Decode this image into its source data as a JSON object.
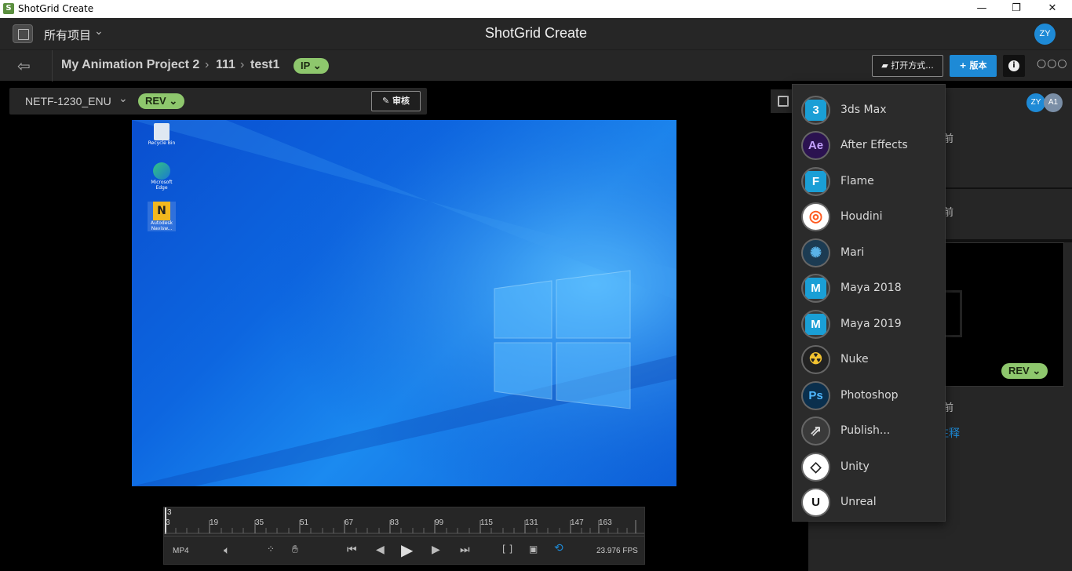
{
  "window": {
    "title": "ShotGrid Create",
    "minimize": "—",
    "restore": "❐",
    "close": "✕"
  },
  "header": {
    "projects_label": "所有项目",
    "app_title": "ShotGrid Create",
    "user_initials": "ZY"
  },
  "breadcrumb": {
    "project": "My Animation Project 2",
    "sep1": "›",
    "shot": "111",
    "sep2": "›",
    "task": "test1",
    "status": "IP",
    "open_with_label": "打开方式...",
    "version_label": "版本"
  },
  "version_bar": {
    "version_name": "NETF-1230_ENU",
    "status": "REV",
    "review_label": "审核"
  },
  "desktop": {
    "icons": [
      {
        "label": "Recycle Bin"
      },
      {
        "label": "Microsoft Edge"
      },
      {
        "label": "Autodesk Navisw..."
      }
    ]
  },
  "timeline": {
    "current_frame": "3",
    "ticks": [
      "3",
      "19",
      "35",
      "51",
      "67",
      "83",
      "99",
      "115",
      "131",
      "147",
      "163"
    ],
    "format": "MP4",
    "fps": "23.976 FPS"
  },
  "right_panel": {
    "avatars": [
      "ZY",
      "A1"
    ],
    "frag1": "前",
    "frag2": "前",
    "frag3": "前",
    "link_frag": "注释",
    "status": "REV"
  },
  "open_menu": {
    "items": [
      {
        "label": "3ds Max",
        "icon": "3dsmax-icon",
        "glyph": "3",
        "color": "#1a9fd6"
      },
      {
        "label": "After Effects",
        "icon": "after-effects-icon",
        "glyph": "Ae",
        "color": "#2b1250"
      },
      {
        "label": "Flame",
        "icon": "flame-icon",
        "glyph": "F",
        "color": "#1a9fd6"
      },
      {
        "label": "Houdini",
        "icon": "houdini-icon",
        "glyph": "◎",
        "color": "#ff5a1f"
      },
      {
        "label": "Mari",
        "icon": "mari-icon",
        "glyph": "✺",
        "color": "#1c3b52"
      },
      {
        "label": "Maya 2018",
        "icon": "maya-icon",
        "glyph": "M",
        "color": "#1a9fd6"
      },
      {
        "label": "Maya 2019",
        "icon": "maya-icon",
        "glyph": "M",
        "color": "#1a9fd6"
      },
      {
        "label": "Nuke",
        "icon": "nuke-icon",
        "glyph": "☢",
        "color": "#f2c230"
      },
      {
        "label": "Photoshop",
        "icon": "photoshop-icon",
        "glyph": "Ps",
        "color": "#0a2f4d"
      },
      {
        "label": "Publish...",
        "icon": "publish-icon",
        "glyph": "⇗",
        "color": "#3a3a3a"
      },
      {
        "label": "Unity",
        "icon": "unity-icon",
        "glyph": "◇",
        "color": "#ffffff"
      },
      {
        "label": "Unreal",
        "icon": "unreal-icon",
        "glyph": "U",
        "color": "#ffffff"
      }
    ]
  }
}
